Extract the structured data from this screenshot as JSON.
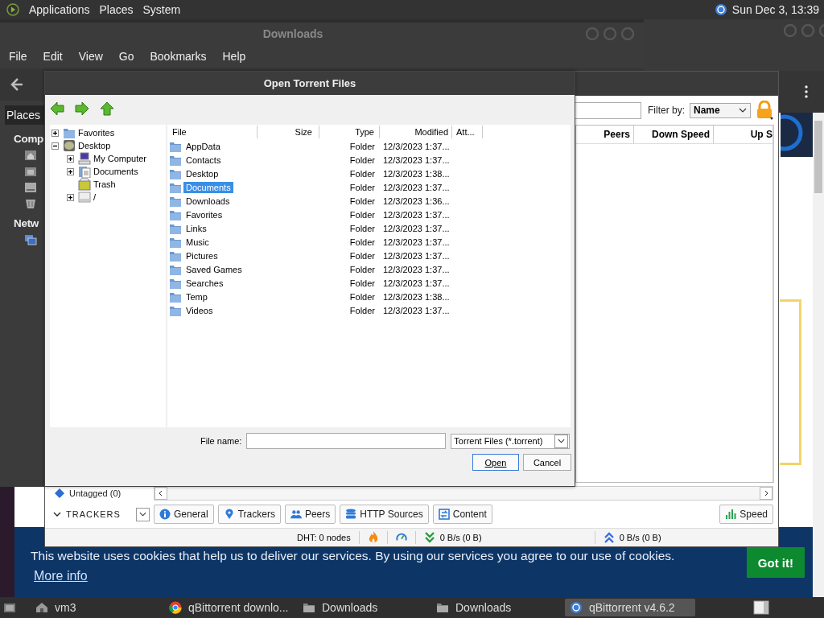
{
  "top_panel": {
    "menus": [
      "Applications",
      "Places",
      "System"
    ],
    "clock": "Sun Dec  3, 13:39"
  },
  "browser": {
    "cookie_text": "This website uses cookies that help us to deliver our services. By using our services you agree to our use of cookies.",
    "more_info": "More info",
    "accept": "Got it!"
  },
  "file_manager": {
    "title": "Downloads",
    "menu": [
      "File",
      "Edit",
      "View",
      "Go",
      "Bookmarks",
      "Help"
    ],
    "sidebar_tab": "Places",
    "headings": [
      "Comp",
      "Netw"
    ]
  },
  "qbittorrent": {
    "filter_label": "Filter by:",
    "filter_value": "Name",
    "columns": [
      "Peers",
      "Down Speed",
      "Up S"
    ],
    "tag": "Untagged (0)",
    "trackers": "TRACKERS",
    "tabs": [
      "General",
      "Trackers",
      "Peers",
      "HTTP Sources",
      "Content"
    ],
    "speed": "Speed",
    "dht": "DHT: 0 nodes",
    "down": "0 B/s (0 B)",
    "up": "0 B/s (0 B)"
  },
  "dialog": {
    "title": "Open Torrent Files",
    "tree": [
      {
        "label": "Favorites",
        "kind": "folder",
        "expanded": false
      },
      {
        "label": "Desktop",
        "kind": "desktop",
        "expanded": true,
        "children": [
          {
            "label": "My Computer",
            "kind": "computer",
            "expanded": false
          },
          {
            "label": "Documents",
            "kind": "documents",
            "expanded": false
          },
          {
            "label": "Trash",
            "kind": "trash"
          },
          {
            "label": "/",
            "kind": "drive",
            "expanded": false
          }
        ]
      }
    ],
    "columns": [
      "File",
      "Size",
      "Type",
      "Modified",
      "Att..."
    ],
    "rows": [
      {
        "name": "AppData",
        "type": "Folder",
        "modified": "12/3/2023 1:37...",
        "selected": false
      },
      {
        "name": "Contacts",
        "type": "Folder",
        "modified": "12/3/2023 1:37...",
        "selected": false
      },
      {
        "name": "Desktop",
        "type": "Folder",
        "modified": "12/3/2023 1:38...",
        "selected": false
      },
      {
        "name": "Documents",
        "type": "Folder",
        "modified": "12/3/2023 1:37...",
        "selected": true
      },
      {
        "name": "Downloads",
        "type": "Folder",
        "modified": "12/3/2023 1:36...",
        "selected": false
      },
      {
        "name": "Favorites",
        "type": "Folder",
        "modified": "12/3/2023 1:37...",
        "selected": false
      },
      {
        "name": "Links",
        "type": "Folder",
        "modified": "12/3/2023 1:37...",
        "selected": false
      },
      {
        "name": "Music",
        "type": "Folder",
        "modified": "12/3/2023 1:37...",
        "selected": false
      },
      {
        "name": "Pictures",
        "type": "Folder",
        "modified": "12/3/2023 1:37...",
        "selected": false
      },
      {
        "name": "Saved Games",
        "type": "Folder",
        "modified": "12/3/2023 1:37...",
        "selected": false
      },
      {
        "name": "Searches",
        "type": "Folder",
        "modified": "12/3/2023 1:37...",
        "selected": false
      },
      {
        "name": "Temp",
        "type": "Folder",
        "modified": "12/3/2023 1:38...",
        "selected": false
      },
      {
        "name": "Videos",
        "type": "Folder",
        "modified": "12/3/2023 1:37...",
        "selected": false
      }
    ],
    "file_name_label": "File name:",
    "file_type": "Torrent Files (*.torrent)",
    "buttons": [
      "Open",
      "Cancel"
    ]
  },
  "taskbar": {
    "items": [
      {
        "label": "vm3",
        "selected": false
      },
      {
        "label": "qBittorrent downlo...",
        "selected": false
      },
      {
        "label": "Downloads",
        "selected": false
      },
      {
        "label": "Downloads",
        "selected": false
      },
      {
        "label": "qBittorrent v4.6.2",
        "selected": true
      }
    ]
  }
}
